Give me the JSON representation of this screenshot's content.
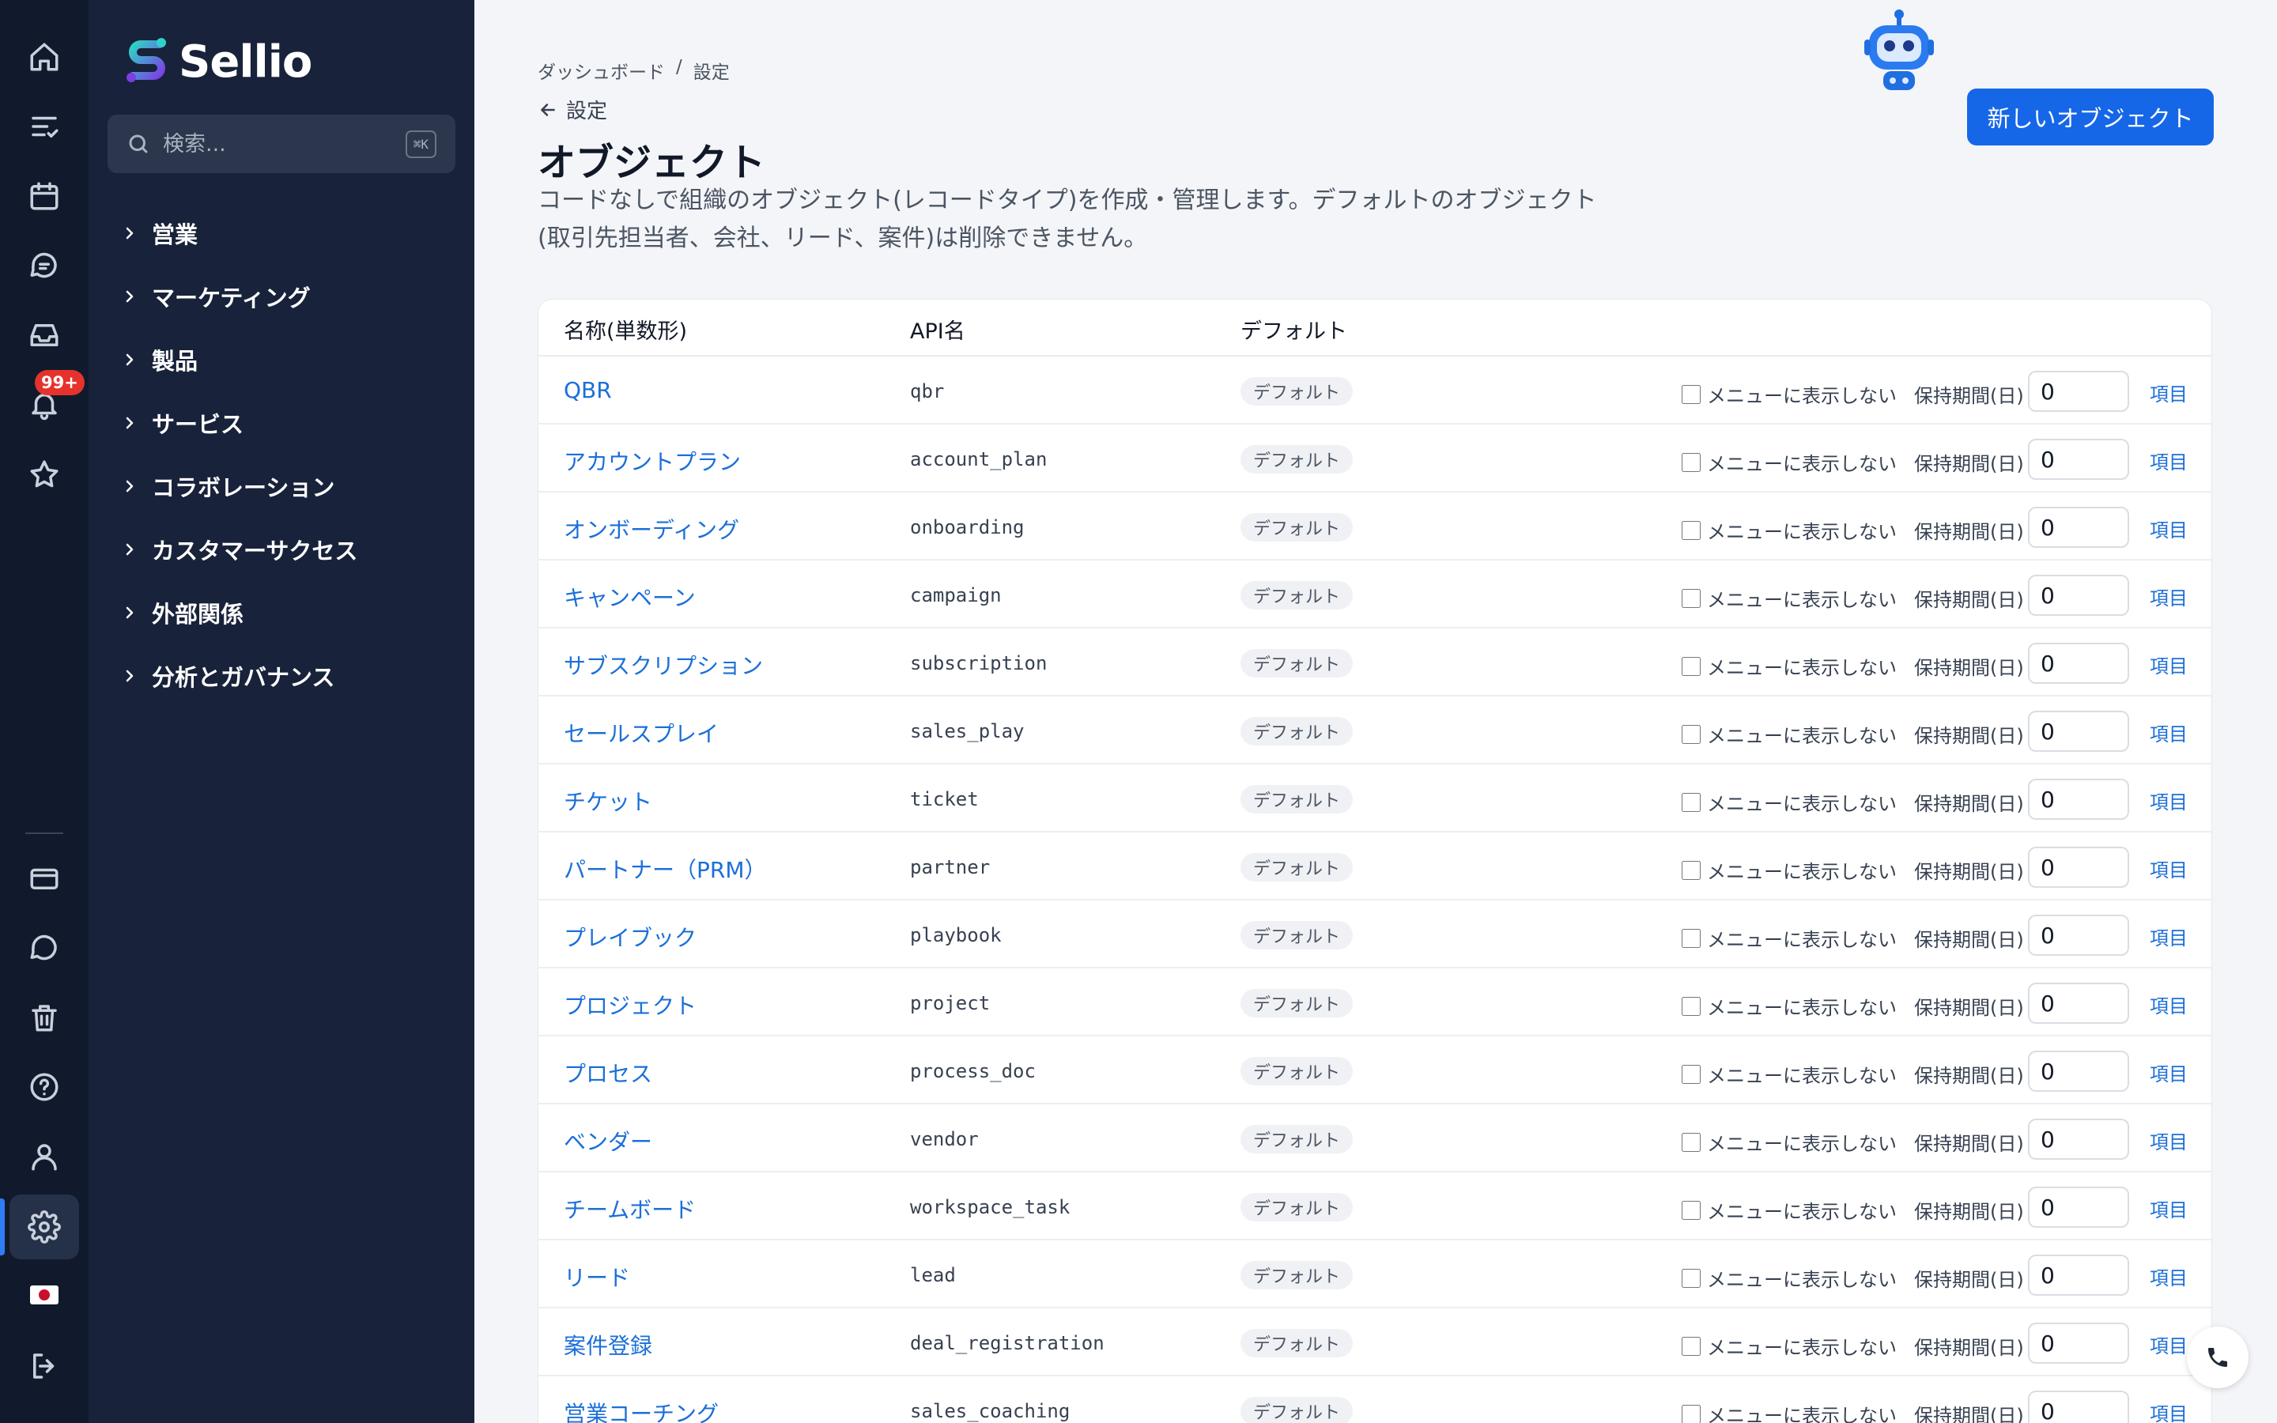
{
  "brand": {
    "name": "Sellio"
  },
  "rail": {
    "notifications_badge": "99+"
  },
  "search": {
    "placeholder": "検索...",
    "shortcut": "⌘K"
  },
  "nav": {
    "items": [
      {
        "label": "営業"
      },
      {
        "label": "マーケティング"
      },
      {
        "label": "製品"
      },
      {
        "label": "サービス"
      },
      {
        "label": "コラボレーション"
      },
      {
        "label": "カスタマーサクセス"
      },
      {
        "label": "外部関係"
      },
      {
        "label": "分析とガバナンス"
      }
    ]
  },
  "breadcrumb": {
    "root": "ダッシュボード",
    "separator": "/",
    "current": "設定"
  },
  "back": {
    "label": "設定"
  },
  "page": {
    "title": "オブジェクト",
    "description": "コードなしで組織のオブジェクト(レコードタイプ)を作成・管理します。デフォルトのオブジェクト(取引先担当者、会社、リード、案件)は削除できません。",
    "new_button": "新しいオブジェクト"
  },
  "table": {
    "headers": {
      "name": "名称(単数形)",
      "api": "API名",
      "default": "デフォルト"
    },
    "row_labels": {
      "tag": "デフォルト",
      "hide": "メニューに表示しない",
      "retention": "保持期間(日)",
      "link": "項目"
    },
    "rows": [
      {
        "name": "QBR",
        "api": "qbr",
        "retention": "0"
      },
      {
        "name": "アカウントプラン",
        "api": "account_plan",
        "retention": "0"
      },
      {
        "name": "オンボーディング",
        "api": "onboarding",
        "retention": "0"
      },
      {
        "name": "キャンペーン",
        "api": "campaign",
        "retention": "0"
      },
      {
        "name": "サブスクリプション",
        "api": "subscription",
        "retention": "0"
      },
      {
        "name": "セールスプレイ",
        "api": "sales_play",
        "retention": "0"
      },
      {
        "name": "チケット",
        "api": "ticket",
        "retention": "0"
      },
      {
        "name": "パートナー（PRM）",
        "api": "partner",
        "retention": "0"
      },
      {
        "name": "プレイブック",
        "api": "playbook",
        "retention": "0"
      },
      {
        "name": "プロジェクト",
        "api": "project",
        "retention": "0"
      },
      {
        "name": "プロセス",
        "api": "process_doc",
        "retention": "0"
      },
      {
        "name": "ベンダー",
        "api": "vendor",
        "retention": "0"
      },
      {
        "name": "チームボード",
        "api": "workspace_task",
        "retention": "0"
      },
      {
        "name": "リード",
        "api": "lead",
        "retention": "0"
      },
      {
        "name": "案件登録",
        "api": "deal_registration",
        "retention": "0"
      },
      {
        "name": "営業コーチング",
        "api": "sales_coaching",
        "retention": "0"
      }
    ]
  },
  "colors": {
    "accent": "#1667e8",
    "sidebar": "#18223a",
    "rail": "#111a2c",
    "badge": "#e5322d"
  }
}
